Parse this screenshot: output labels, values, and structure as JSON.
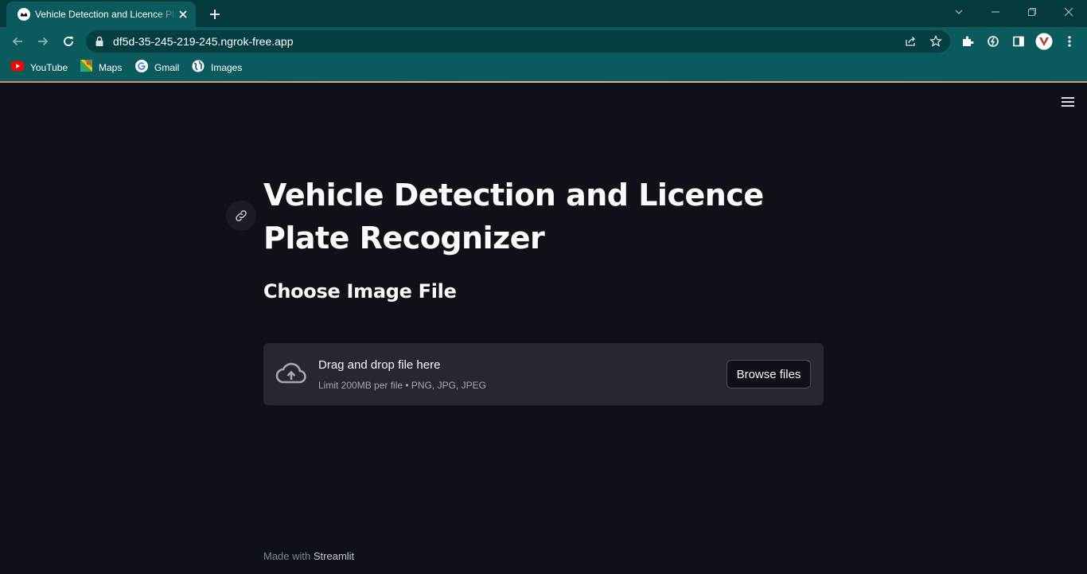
{
  "browser": {
    "tab_title": "Vehicle Detection and Licence Plate Recognizer",
    "url": "df5d-35-245-219-245.ngrok-free.app",
    "bookmarks": [
      {
        "label": "YouTube",
        "icon": "youtube-icon"
      },
      {
        "label": "Maps",
        "icon": "maps-icon"
      },
      {
        "label": "Gmail",
        "icon": "google-icon"
      },
      {
        "label": "Images",
        "icon": "globe-icon"
      }
    ]
  },
  "page": {
    "title": "Vehicle Detection and Licence Plate Recognizer",
    "subheader": "Choose Image File"
  },
  "uploader": {
    "drag_text": "Drag and drop file here",
    "limit_text": "Limit 200MB per file • PNG, JPG, JPEG",
    "browse_label": "Browse files"
  },
  "footer": {
    "made_with": "Made with",
    "brand": "Streamlit"
  },
  "colors": {
    "background": "#0e1117",
    "dropzone": "#262730",
    "chrome": "#0b5b5e",
    "titlebar": "#053a3c"
  }
}
